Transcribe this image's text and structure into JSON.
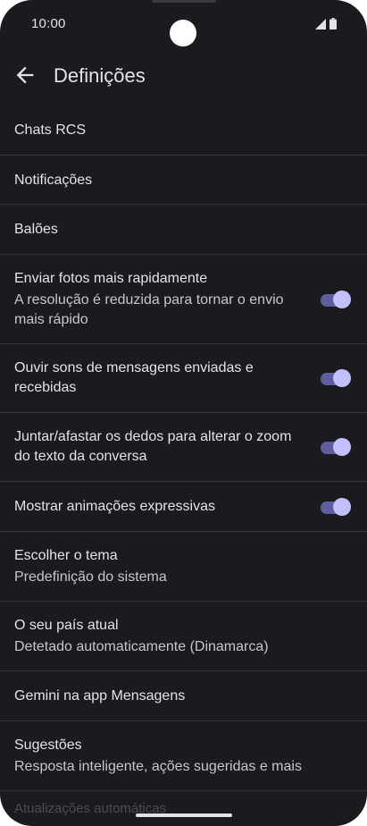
{
  "status": {
    "time": "10:00"
  },
  "appbar": {
    "title": "Definições"
  },
  "items": [
    {
      "title": "Chats RCS"
    },
    {
      "title": "Notificações"
    },
    {
      "title": "Balões"
    },
    {
      "title": "Enviar fotos mais rapidamente",
      "subtitle": "A resolução é reduzida para tornar o envio mais rápido",
      "toggle": true
    },
    {
      "title": "Ouvir sons de mensagens enviadas e recebidas",
      "toggle": true
    },
    {
      "title": "Juntar/afastar os dedos para alterar o zoom do texto da conversa",
      "toggle": true
    },
    {
      "title": "Mostrar animações expressivas",
      "toggle": true
    },
    {
      "title": "Escolher o tema",
      "subtitle": "Predefinição do sistema"
    },
    {
      "title": "O seu país atual",
      "subtitle": "Detetado automaticamente (Dinamarca)"
    },
    {
      "title": "Gemini na app Mensagens"
    },
    {
      "title": "Sugestões",
      "subtitle": "Resposta inteligente, ações sugeridas e mais"
    }
  ],
  "partial_item": {
    "title": "Atualizações automáticas"
  },
  "colors": {
    "background": "#1b1b1f",
    "toggle_track": "#5e5d9e",
    "toggle_thumb": "#c4c0ff"
  }
}
